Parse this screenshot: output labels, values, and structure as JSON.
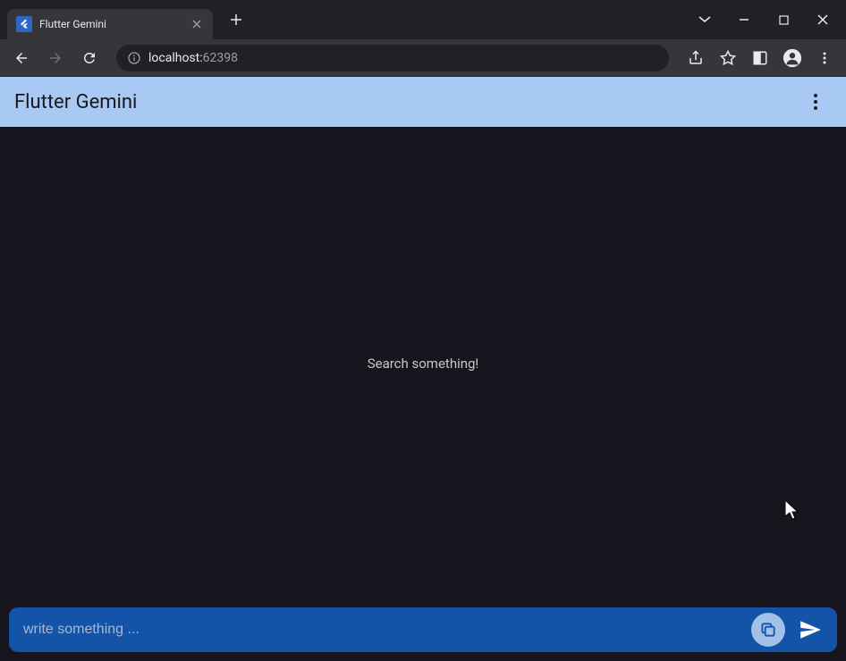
{
  "browser": {
    "tab_title": "Flutter Gemini",
    "url_host": "localhost:",
    "url_port": "62398"
  },
  "app": {
    "title": "Flutter Gemini",
    "empty_state": "Search something!",
    "input_placeholder": "write something ..."
  }
}
